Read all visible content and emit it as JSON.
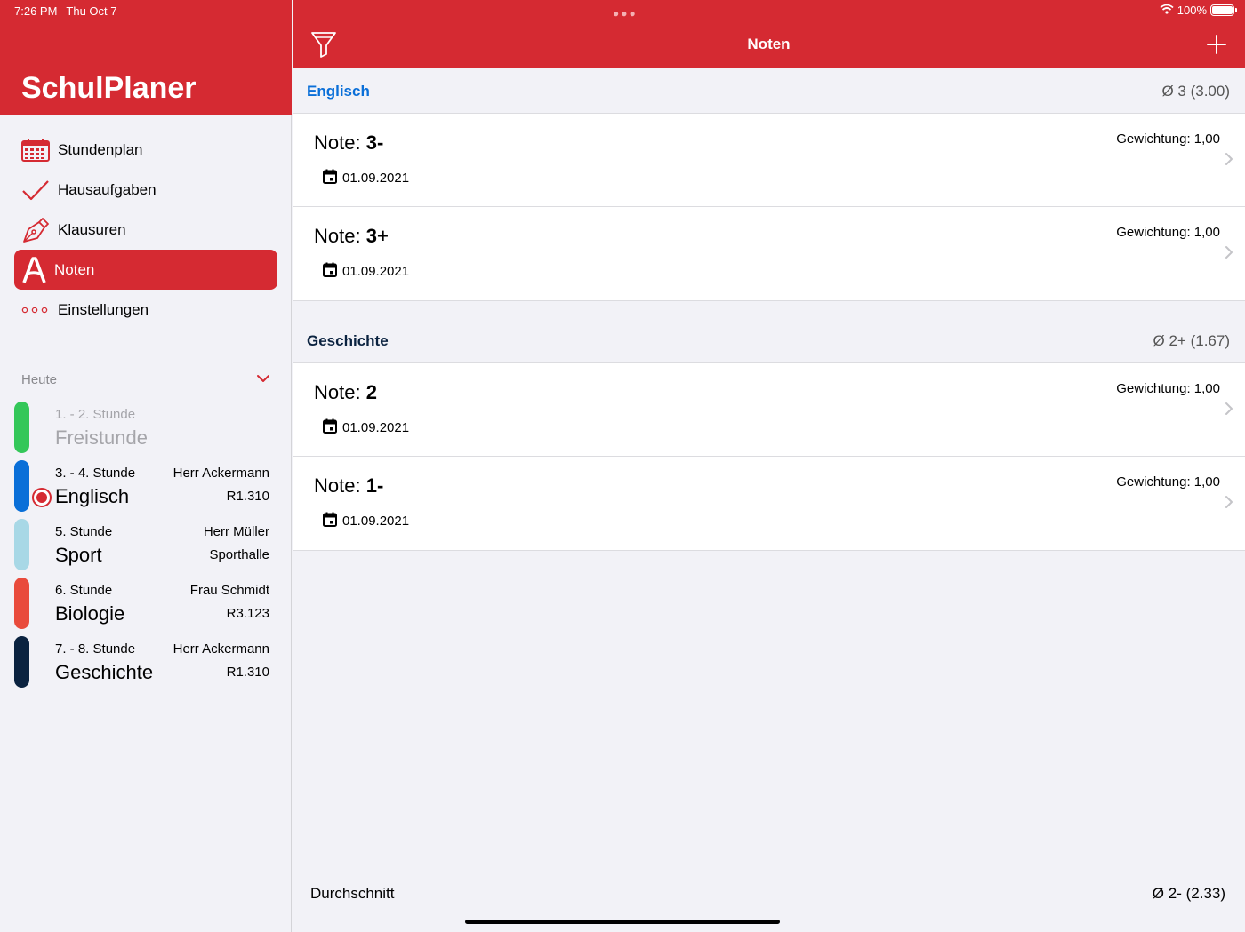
{
  "status": {
    "time": "7:26 PM",
    "date": "Thu Oct 7",
    "battery": "100%"
  },
  "sidebar": {
    "app_title": "SchulPlaner",
    "menu": [
      {
        "label": "Stundenplan",
        "icon": "calendar-grid-icon",
        "active": false
      },
      {
        "label": "Hausaufgaben",
        "icon": "checkmark-icon",
        "active": false
      },
      {
        "label": "Klausuren",
        "icon": "pen-nib-icon",
        "active": false
      },
      {
        "label": "Noten",
        "icon": "letter-a-icon",
        "active": true
      },
      {
        "label": "Einstellungen",
        "icon": "more-dots-icon",
        "active": false
      }
    ],
    "today_label": "Heute",
    "lessons": [
      {
        "time": "1. - 2. Stunde",
        "subject": "Freistunde",
        "teacher": "",
        "room": "",
        "color": "#34c759",
        "muted": true
      },
      {
        "time": "3. - 4. Stunde",
        "subject": "Englisch",
        "teacher": "Herr Ackermann",
        "room": "R1.310",
        "color": "#0a6fd8",
        "current": true
      },
      {
        "time": "5. Stunde",
        "subject": "Sport",
        "teacher": "Herr Müller",
        "room": "Sporthalle",
        "color": "#a8d8e6"
      },
      {
        "time": "6. Stunde",
        "subject": "Biologie",
        "teacher": "Frau Schmidt",
        "room": "R3.123",
        "color": "#e94b3c"
      },
      {
        "time": "7. - 8. Stunde",
        "subject": "Geschichte",
        "teacher": "Herr Ackermann",
        "room": "R1.310",
        "color": "#0b2340"
      }
    ]
  },
  "main": {
    "nav_title": "Noten",
    "sections": [
      {
        "name": "Englisch",
        "name_color": "#0a6fd8",
        "average": "Ø 3 (3.00)",
        "grades": [
          {
            "prefix": "Note: ",
            "grade": "3-",
            "date": "01.09.2021",
            "weight": "Gewichtung: 1,00"
          },
          {
            "prefix": "Note: ",
            "grade": "3+",
            "date": "01.09.2021",
            "weight": "Gewichtung: 1,00"
          }
        ]
      },
      {
        "name": "Geschichte",
        "name_color": "#0b2340",
        "average": "Ø 2+ (1.67)",
        "grades": [
          {
            "prefix": "Note: ",
            "grade": "2",
            "date": "01.09.2021",
            "weight": "Gewichtung: 1,00"
          },
          {
            "prefix": "Note: ",
            "grade": "1-",
            "date": "01.09.2021",
            "weight": "Gewichtung: 1,00"
          }
        ]
      }
    ],
    "footer": {
      "label": "Durchschnitt",
      "value": "Ø 2- (2.33)"
    }
  },
  "colors": {
    "accent": "#d52a32",
    "background": "#f2f2f7"
  }
}
